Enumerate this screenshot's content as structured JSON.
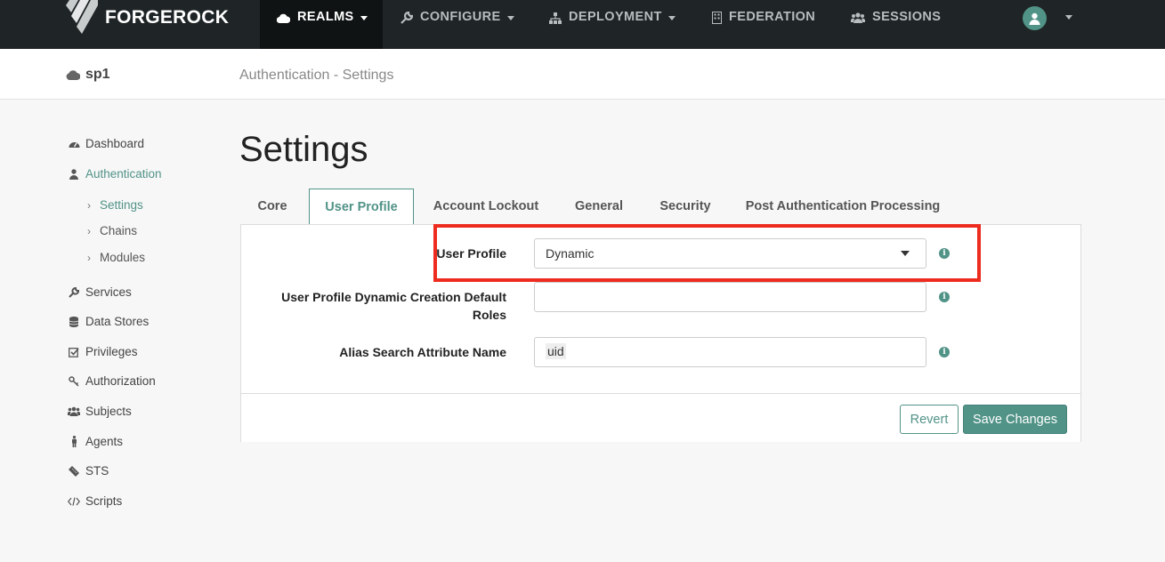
{
  "brand": {
    "name": "FORGEROCK",
    "accent": "#519387",
    "nav_bg": "#1f2426"
  },
  "topnav": {
    "items": [
      {
        "label": "REALMS",
        "icon": "cloud-icon",
        "active": true,
        "dropdown": true
      },
      {
        "label": "CONFIGURE",
        "icon": "wrench-icon",
        "dropdown": true
      },
      {
        "label": "DEPLOYMENT",
        "icon": "sitemap-icon",
        "dropdown": true
      },
      {
        "label": "FEDERATION",
        "icon": "building-icon",
        "dropdown": false
      },
      {
        "label": "SESSIONS",
        "icon": "users-icon",
        "dropdown": false
      }
    ],
    "user_icon": "user-avatar-icon"
  },
  "subheader": {
    "realm": "sp1",
    "breadcrumb": "Authentication - Settings"
  },
  "sidebar": {
    "items": [
      {
        "label": "Dashboard",
        "icon": "dashboard-icon"
      },
      {
        "label": "Authentication",
        "icon": "user-icon",
        "active": true
      },
      {
        "label": "Settings",
        "sub": true,
        "active": true
      },
      {
        "label": "Chains",
        "sub": true
      },
      {
        "label": "Modules",
        "sub": true
      },
      {
        "label": "Services",
        "icon": "wrench-icon"
      },
      {
        "label": "Data Stores",
        "icon": "database-icon"
      },
      {
        "label": "Privileges",
        "icon": "checkbox-icon"
      },
      {
        "label": "Authorization",
        "icon": "key-icon"
      },
      {
        "label": "Subjects",
        "icon": "users-icon"
      },
      {
        "label": "Agents",
        "icon": "male-icon"
      },
      {
        "label": "STS",
        "icon": "ticket-icon"
      },
      {
        "label": "Scripts",
        "icon": "code-icon"
      }
    ]
  },
  "main": {
    "title": "Settings",
    "tabs": [
      {
        "label": "Core"
      },
      {
        "label": "User Profile",
        "active": true
      },
      {
        "label": "Account Lockout"
      },
      {
        "label": "General"
      },
      {
        "label": "Security"
      },
      {
        "label": "Post Authentication Processing"
      }
    ],
    "fields": {
      "user_profile": {
        "label": "User Profile",
        "value": "Dynamic"
      },
      "dynamic_roles": {
        "label_line1": "User Profile Dynamic Creation Default",
        "label_line2": "Roles",
        "value": ""
      },
      "alias_search": {
        "label": "Alias Search Attribute Name",
        "value": "uid"
      }
    },
    "info_glyph": "i",
    "buttons": {
      "revert": "Revert",
      "save": "Save Changes"
    }
  }
}
